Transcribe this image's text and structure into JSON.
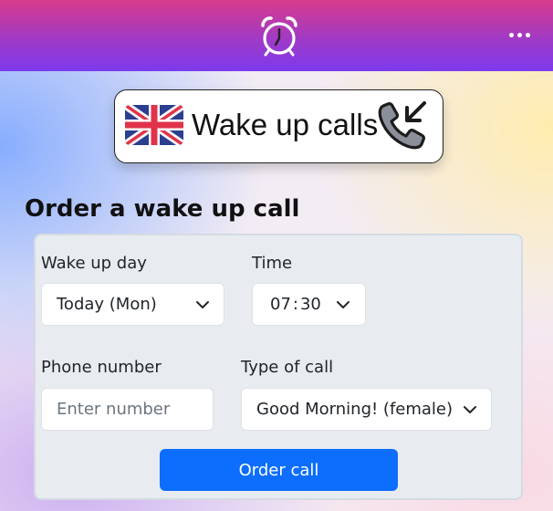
{
  "header": {
    "app_icon": "alarm-clock-icon",
    "menu_icon": "more-horizontal-icon",
    "gradient_colors": [
      "#d93b8c",
      "#7c3aed"
    ]
  },
  "banner": {
    "flag_icon": "uk-flag-icon",
    "title": "Wake up calls",
    "call_icon": "incoming-call-icon"
  },
  "form": {
    "title": "Order a wake up call",
    "wake_day": {
      "label": "Wake up day",
      "value": "Today (Mon)"
    },
    "time": {
      "label": "Time",
      "hour": "07",
      "separator": ":",
      "minute": "30"
    },
    "phone": {
      "label": "Phone number",
      "placeholder": "Enter number",
      "value": ""
    },
    "call_type": {
      "label": "Type of call",
      "value": "Good Morning! (female)"
    },
    "submit_label": "Order call",
    "accent_color": "#0d6efd"
  }
}
